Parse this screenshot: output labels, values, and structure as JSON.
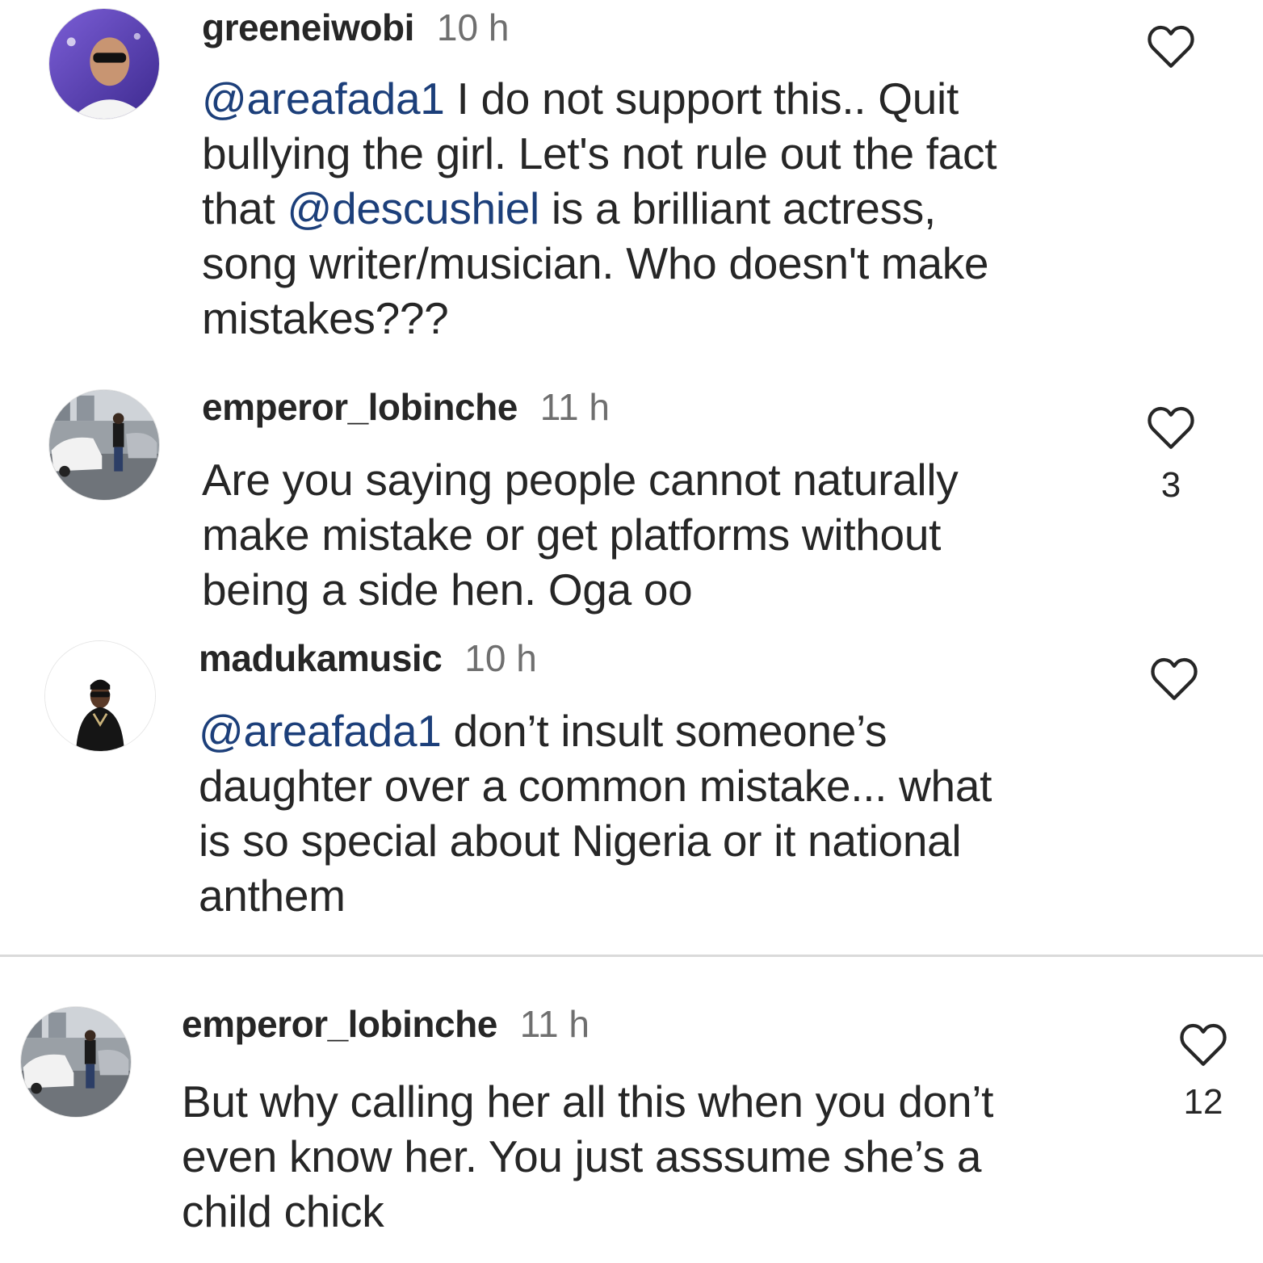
{
  "comments": [
    {
      "username": "greeneiwobi",
      "time": "10 h",
      "lines": [
        [
          {
            "m": "@areafada1"
          },
          {
            "t": " I do not support this.. Quit"
          }
        ],
        [
          {
            "t": "bullying the girl. Let's not rule out the fact"
          }
        ],
        [
          {
            "t": "that "
          },
          {
            "m": "@descushiel"
          },
          {
            "t": " is a brilliant actress,"
          }
        ],
        [
          {
            "t": "song writer/musician. Who doesn't make"
          }
        ],
        [
          {
            "t": "mistakes???"
          }
        ]
      ],
      "likes": ""
    },
    {
      "username": "emperor_lobinche",
      "time": "11 h",
      "lines": [
        [
          {
            "t": "Are you saying people cannot naturally"
          }
        ],
        [
          {
            "t": "make mistake or get platforms without"
          }
        ],
        [
          {
            "t": "being a side hen. Oga oo"
          }
        ]
      ],
      "likes": "3"
    },
    {
      "username": "madukamusic",
      "time": "10 h",
      "lines": [
        [
          {
            "m": "@areafada1"
          },
          {
            "t": " don’t insult someone’s"
          }
        ],
        [
          {
            "t": "daughter over a common mistake... what"
          }
        ],
        [
          {
            "t": "is so special about Nigeria or it national"
          }
        ],
        [
          {
            "t": "anthem"
          }
        ]
      ],
      "likes": ""
    },
    {
      "username": "emperor_lobinche",
      "time": "11 h",
      "lines": [
        [
          {
            "t": "But why calling her all this when you don’t"
          }
        ],
        [
          {
            "t": "even know her. You just asssume she’s a"
          }
        ],
        [
          {
            "t": "child chick"
          }
        ]
      ],
      "likes": "12"
    }
  ],
  "icons": {
    "like": "heart-outline-icon"
  },
  "colors": {
    "mention": "#1c3f7a",
    "time": "#6f6f6f",
    "text": "#262626"
  }
}
